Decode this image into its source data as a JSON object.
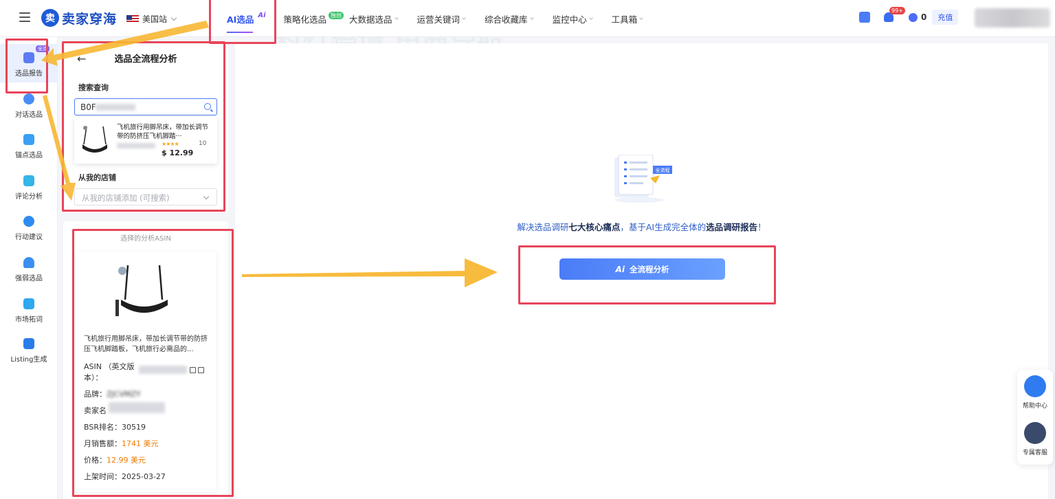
{
  "nav": {
    "site": "美国站",
    "tabs": [
      {
        "label": "AI选品",
        "sup": "Ai"
      },
      {
        "label": "策略化选品",
        "badge": "独创"
      },
      {
        "label": "大数据选品"
      },
      {
        "label": "运营关键词"
      },
      {
        "label": "综合收藏库"
      },
      {
        "label": "监控中心"
      },
      {
        "label": "工具箱"
      }
    ],
    "notifications": "99+",
    "coins": "0",
    "recharge": "充值"
  },
  "logo": {
    "mark": "卖",
    "text": "卖家穿海"
  },
  "rail": {
    "items": [
      {
        "label": "选品报告",
        "chip": "全流"
      },
      {
        "label": "对话选品"
      },
      {
        "label": "锚点选品"
      },
      {
        "label": "评论分析"
      },
      {
        "label": "行动建议"
      },
      {
        "label": "强弱选品"
      },
      {
        "label": "市场拓词"
      },
      {
        "label": "Listing生成"
      }
    ]
  },
  "panel": {
    "title": "选品全流程分析",
    "search_label": "搜索查询",
    "search_value": "B0F",
    "result": {
      "title": "飞机旅行用脚吊床，带加长调节带的防挤压飞机脚踏···",
      "stars": "★★★★",
      "reviews": "10",
      "price": "$ 12.99"
    },
    "store_label": "从我的店铺",
    "store_placeholder": "从我的店铺添加 (可搜索)"
  },
  "selected": {
    "header": "选择的分析ASIN",
    "title": "飞机旅行用脚吊床，带加长调节带的防挤压飞机脚踏板，飞机旅行必需品的...",
    "asin_label": "ASIN （英文版本）：",
    "brand_label": "品牌：",
    "brand_value": "ZJCVMZY",
    "seller_label": "卖家名",
    "bsr_label": "BSR排名：",
    "bsr_value": "30519",
    "sales_label": "月销售额：",
    "sales_value": "1741 美元",
    "price_label": "价格：",
    "price_value": "12.99 美元",
    "date_label": "上架时间：",
    "date_value": "2025-03-27"
  },
  "main": {
    "illustration_tag": "全流程",
    "tagline_pre": "解决选品调研",
    "tagline_b1": "七大核心痛点",
    "tagline_mid": "，基于AI生成完全体的",
    "tagline_b2": "选品调研报告",
    "tagline_post": "！",
    "cta_ai": "Ai",
    "cta_label": "全流程分析"
  },
  "float": {
    "help": "帮助中心",
    "service": "专属客服"
  },
  "watermark": "科灯跨境 电商导航",
  "colors": {
    "accent": "#2f54eb",
    "annotation": "#e8455a",
    "arrow": "#f7b733",
    "price": "#f07c00"
  }
}
